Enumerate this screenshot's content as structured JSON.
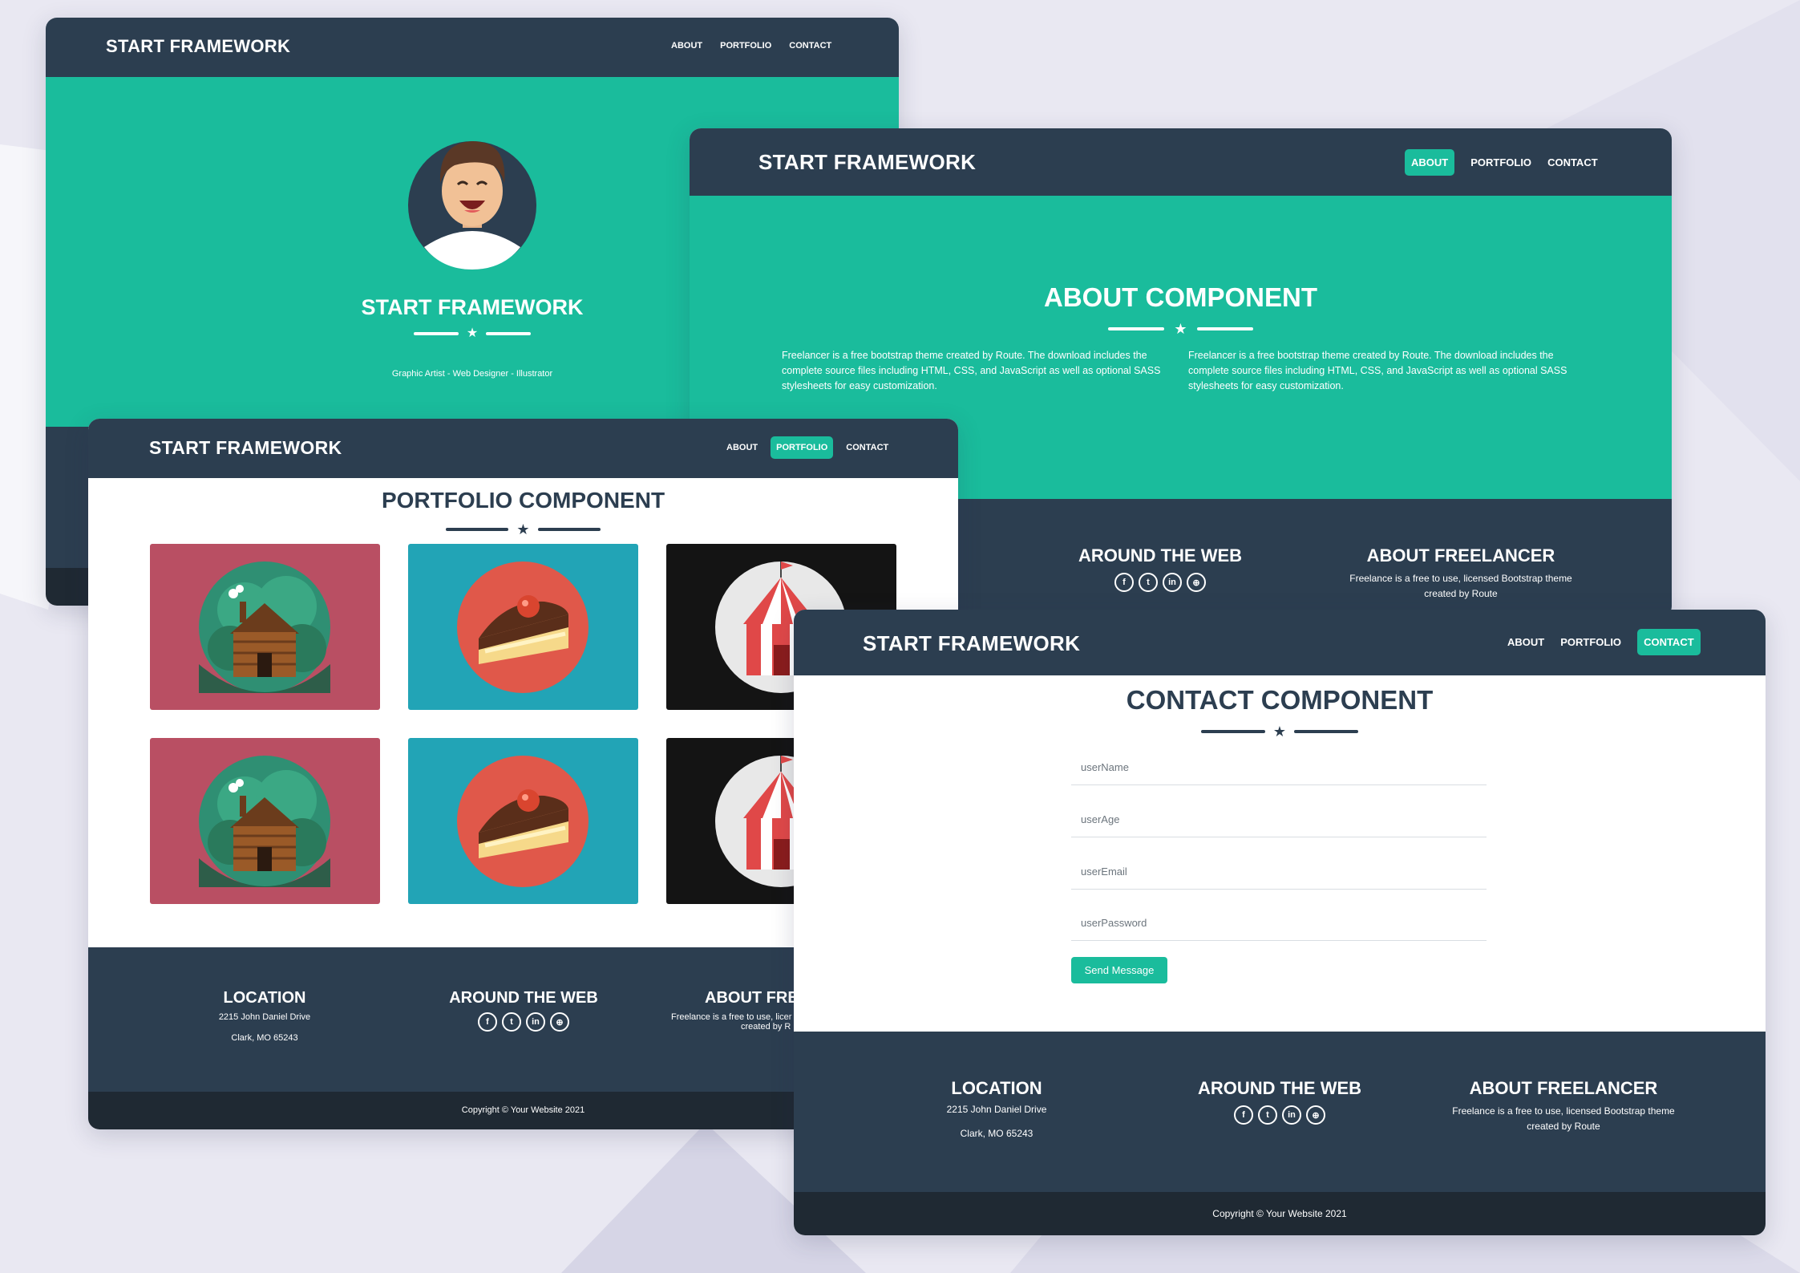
{
  "brand": "START FRAMEWORK",
  "nav": {
    "about": "ABOUT",
    "portfolio": "PORTFOLIO",
    "contact": "CONTACT"
  },
  "home": {
    "title": "START FRAMEWORK",
    "subtitle": "Graphic Artist - Web Designer - Illustrator"
  },
  "about": {
    "title": "ABOUT COMPONENT",
    "paragraph_left": "Freelancer is a free bootstrap theme created by Route. The download includes the complete source files including HTML, CSS, and JavaScript as well as optional SASS stylesheets for easy customization.",
    "paragraph_right": "Freelancer is a free bootstrap theme created by Route. The download includes the complete source files including HTML, CSS, and JavaScript as well as optional SASS stylesheets for easy customization."
  },
  "portfolio": {
    "title": "PORTFOLIO COMPONENT",
    "items": [
      "cabin",
      "cake",
      "circus",
      "cabin",
      "cake",
      "circus"
    ]
  },
  "contact": {
    "title": "CONTACT COMPONENT",
    "fields": {
      "name_placeholder": "userName",
      "age_placeholder": "userAge",
      "email_placeholder": "userEmail",
      "password_placeholder": "userPassword"
    },
    "button": "Send Message"
  },
  "footer": {
    "location_title": "LOCATION",
    "address_line1": "2215 John Daniel Drive",
    "address_line2": "Clark, MO 65243",
    "web_title": "AROUND THE WEB",
    "about_title": "ABOUT FREELANCER",
    "about_text": "Freelance is a free to use, licensed Bootstrap theme created by Route",
    "portfolio_about_title_cropped": "ABOUT FREE",
    "portfolio_about_text_line1": "Freelance is a free to use, licer",
    "portfolio_about_text_line2": "created by R",
    "copyright": "Copyright © Your Website 2021"
  },
  "social_icons": [
    "facebook-icon",
    "twitter-icon",
    "linkedin-icon",
    "dribbble-icon"
  ],
  "colors": {
    "primary": "#2c3e50",
    "accent": "#1abc9c",
    "footer_bottom": "#1f2933",
    "cabin_bg": "#b94f63",
    "cake_bg": "#22a4b6",
    "circus_bg": "#141414"
  }
}
